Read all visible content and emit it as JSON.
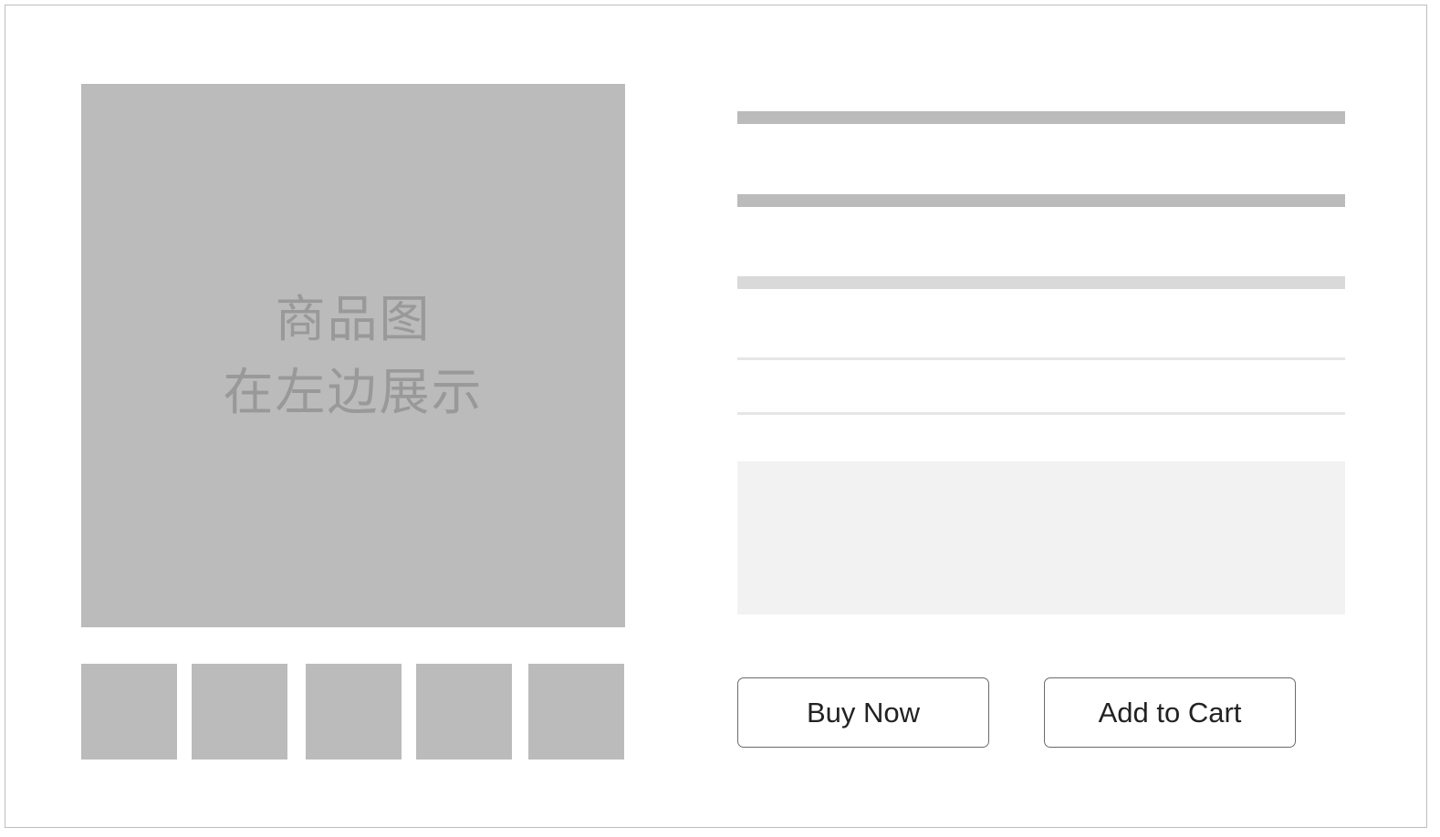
{
  "product": {
    "main_image": {
      "caption_line1": "商品图",
      "caption_line2": "在左边展示"
    },
    "thumbnail_count": 5
  },
  "actions": {
    "buy_now_label": "Buy Now",
    "add_to_cart_label": "Add to Cart"
  },
  "colors": {
    "placeholder": "#bbbbbb",
    "placeholder_light": "#d9d9d9",
    "divider": "#e6e6e6",
    "description_bg": "#f2f2f2",
    "button_border": "#6b6b6b",
    "caption_text": "#999999"
  }
}
